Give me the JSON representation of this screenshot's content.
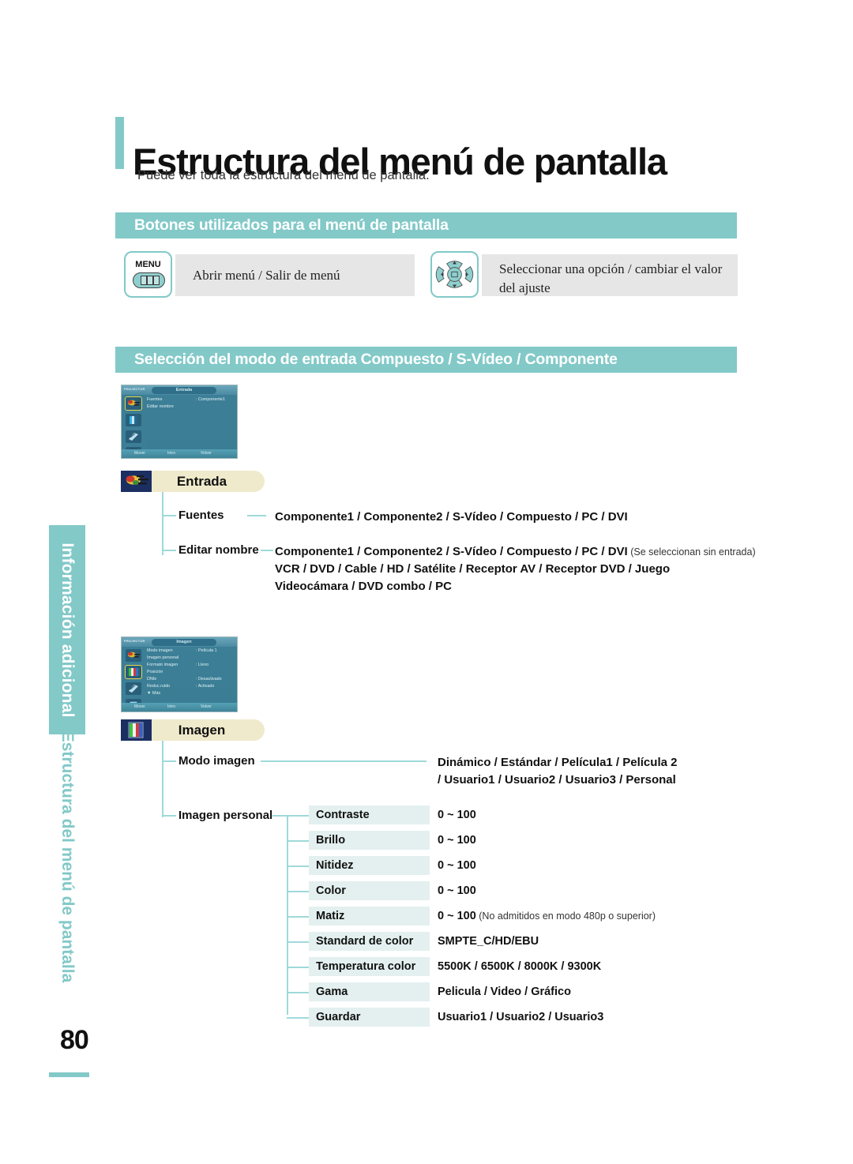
{
  "page": {
    "number": "80",
    "title": "Estructura del menú de pantalla",
    "subtitle": "Puede ver toda la estructura del menú de pantalla."
  },
  "sidebar": {
    "tab_label": "Información adicional",
    "sub_label": "Estructura del menú de pantalla"
  },
  "sections": {
    "buttons": {
      "header": "Botones utilizados para el menú de pantalla",
      "keys": [
        {
          "icon": "menu-button-icon",
          "label": "MENU",
          "description": "Abrir menú / Salir de menú"
        },
        {
          "icon": "dpad-button-icon",
          "label": "",
          "description": "Seleccionar una opción / cambiar el valor del ajuste"
        }
      ]
    },
    "input_mode": {
      "header": "Selección del modo de entrada Compuesto / S-Vídeo / Componente"
    }
  },
  "osd_entrada": {
    "brand": "PROJECTOR",
    "tab_title": "Entrada",
    "rows": [
      {
        "label": "Fuentes",
        "value": ": Componente1",
        "arrow": "▶"
      },
      {
        "label": "Editar nombre",
        "value": "",
        "arrow": "▶"
      }
    ],
    "footer": {
      "move": "Mover",
      "enter": "Intro",
      "return": "Volver"
    }
  },
  "osd_imagen": {
    "brand": "PROJECTOR",
    "tab_title": "Imagen",
    "rows": [
      {
        "label": "Modo imagen",
        "value": ": Película 1",
        "arrow": "▶"
      },
      {
        "label": "Imagen personal",
        "value": "",
        "arrow": "▶"
      },
      {
        "label": "Formato imagen",
        "value": ": Lleno",
        "arrow": "▶"
      },
      {
        "label": "Posición",
        "value": "",
        "arrow": "▶"
      },
      {
        "label": "DNIe",
        "value": ": Desactivado",
        "arrow": "▶"
      },
      {
        "label": "Reduc.ruido",
        "value": ": Activado",
        "arrow": "▶"
      },
      {
        "label": "▼ Más",
        "value": "",
        "arrow": ""
      }
    ],
    "footer": {
      "move": "Mover",
      "enter": "Intro",
      "return": "Volver"
    }
  },
  "entrada": {
    "badge": "Entrada",
    "badge_icon": "input-connector-icon",
    "items": [
      {
        "label": "Fuentes",
        "lines": [
          {
            "text": "Componente1 / Componente2 / S-Vídeo / Compuesto / PC / DVI",
            "note": ""
          }
        ]
      },
      {
        "label": "Editar nombre",
        "lines": [
          {
            "text": "Componente1 / Componente2 / S-Vídeo / Compuesto / PC / DVI",
            "note": " (Se seleccionan sin entrada)"
          },
          {
            "text": "VCR / DVD / Cable / HD / Satélite / Receptor AV / Receptor DVD / Juego",
            "note": ""
          },
          {
            "text": "Videocámara / DVD combo / PC",
            "note": ""
          }
        ]
      }
    ]
  },
  "imagen": {
    "badge": "Imagen",
    "badge_icon": "picture-colorbars-icon",
    "modo_imagen": {
      "label": "Modo imagen",
      "lines": [
        "Dinámico / Estándar / Película1 / Película 2",
        "/ Usuario1 / Usuario2 / Usuario3 / Personal"
      ]
    },
    "imagen_personal": {
      "label": "Imagen personal",
      "rows": [
        {
          "name": "Contraste",
          "value": "0 ~ 100",
          "note": ""
        },
        {
          "name": "Brillo",
          "value": "0 ~ 100",
          "note": ""
        },
        {
          "name": "Nitidez",
          "value": "0 ~ 100",
          "note": ""
        },
        {
          "name": "Color",
          "value": "0 ~ 100",
          "note": ""
        },
        {
          "name": "Matiz",
          "value": "0 ~ 100",
          "note": " (No admitidos en modo 480p o superior)"
        },
        {
          "name": "Standard de color",
          "value": "SMPTE_C/HD/EBU",
          "note": ""
        },
        {
          "name": "Temperatura color",
          "value": "5500K / 6500K / 8000K / 9300K",
          "note": ""
        },
        {
          "name": "Gama",
          "value": "Pelicula / Video / Gráfico",
          "note": ""
        },
        {
          "name": "Guardar",
          "value": "Usuario1 / Usuario2 / Usuario3",
          "note": ""
        }
      ]
    }
  },
  "colors": {
    "teal": "#82c9c8",
    "chip_bg": "#e3f0ef",
    "badge_bg": "#efeacb",
    "desc_bg": "#e6e6e6",
    "osd_blue": "#3d7f96"
  }
}
